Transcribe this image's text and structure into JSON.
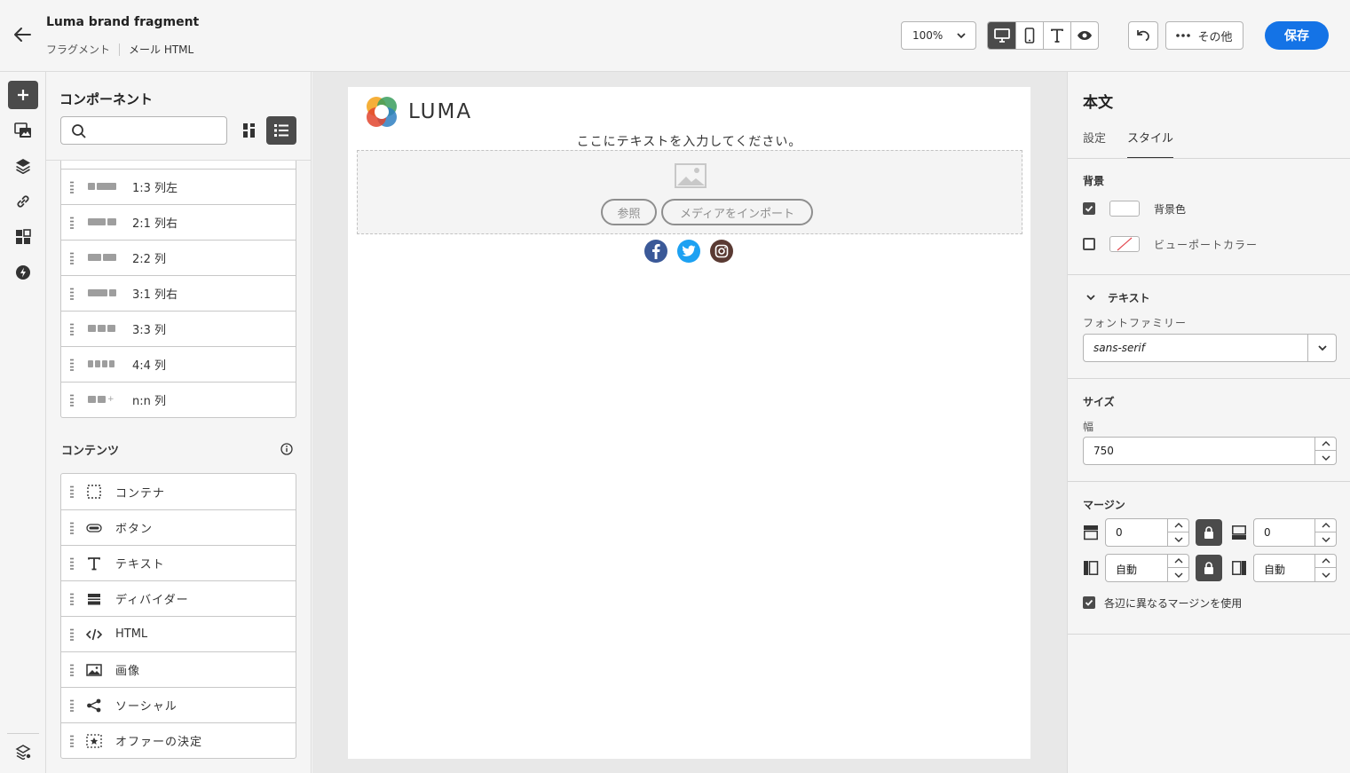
{
  "header": {
    "title": "Luma brand fragment",
    "crumbs": [
      "フラグメント",
      "メール HTML"
    ],
    "zoom": "100%",
    "more_label": "その他",
    "save_label": "保存"
  },
  "components_panel": {
    "title": "コンポーネント",
    "search_placeholder": "",
    "structures": [
      {
        "label": "1:3 列左"
      },
      {
        "label": "2:1 列右"
      },
      {
        "label": "2:2 列"
      },
      {
        "label": "3:1 列右"
      },
      {
        "label": "3:3 列"
      },
      {
        "label": "4:4 列"
      },
      {
        "label": "n:n 列"
      }
    ],
    "contents_title": "コンテンツ",
    "contents": [
      {
        "label": "コンテナ",
        "icon": "container-icon"
      },
      {
        "label": "ボタン",
        "icon": "button-icon"
      },
      {
        "label": "テキスト",
        "icon": "text-icon"
      },
      {
        "label": "ディバイダー",
        "icon": "divider-icon"
      },
      {
        "label": "HTML",
        "icon": "code-icon"
      },
      {
        "label": "画像",
        "icon": "image-icon"
      },
      {
        "label": "ソーシャル",
        "icon": "share-icon"
      },
      {
        "label": "オファーの決定",
        "icon": "offer-icon"
      }
    ]
  },
  "canvas": {
    "brand": "LUMA",
    "placeholder_text": "ここにテキストを入力してください。",
    "browse_label": "参照",
    "import_label": "メディアをインポート",
    "socials": [
      "facebook-icon",
      "twitter-icon",
      "instagram-icon"
    ]
  },
  "properties": {
    "title": "本文",
    "tabs": [
      "設定",
      "スタイル"
    ],
    "active_tab": "スタイル",
    "background": {
      "section": "背景",
      "bg_color_label": "背景色",
      "bg_color_checked": true,
      "viewport_label": "ビューポートカラー",
      "viewport_checked": false
    },
    "text": {
      "section": "テキスト",
      "font_family_label": "フォントファミリー",
      "font_family_value": "sans-serif"
    },
    "size": {
      "section": "サイズ",
      "width_label": "幅",
      "width_value": "750"
    },
    "margin": {
      "section": "マージン",
      "top": "0",
      "bottom": "0",
      "left": "自動",
      "right": "自動",
      "different_sides_label": "各辺に異なるマージンを使用",
      "different_sides_checked": true
    }
  },
  "colors": {
    "accent": "#1473e6",
    "dark_button": "#4b4b4b",
    "facebook": "#3b5998",
    "twitter": "#1da1f2",
    "instagram": "#5a3a33"
  }
}
